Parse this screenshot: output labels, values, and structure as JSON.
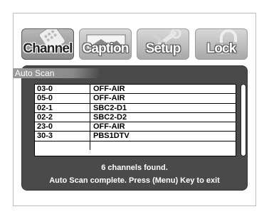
{
  "tabs": [
    {
      "label": "Channel",
      "icon": "remote-icon",
      "active": true
    },
    {
      "label": "Caption",
      "icon": "caption-screen-icon",
      "active": false
    },
    {
      "label": "Setup",
      "icon": "tools-icon",
      "active": false
    },
    {
      "label": "Lock",
      "icon": "padlock-icon",
      "active": false
    }
  ],
  "panel": {
    "title": "Auto Scan",
    "channels": [
      {
        "number": "03-0",
        "name": "OFF-AIR"
      },
      {
        "number": "05-0",
        "name": "OFF-AIR"
      },
      {
        "number": "02-1",
        "name": "SBC2-D1"
      },
      {
        "number": "02-2",
        "name": "SBC2-D2"
      },
      {
        "number": "23-0",
        "name": "OFF-AIR"
      },
      {
        "number": "30-3",
        "name": "PBS1DTV"
      },
      {
        "number": "",
        "name": ""
      }
    ],
    "status_found": "6 channels found.",
    "status_complete": "Auto Scan complete. Press (Menu) Key to exit"
  }
}
